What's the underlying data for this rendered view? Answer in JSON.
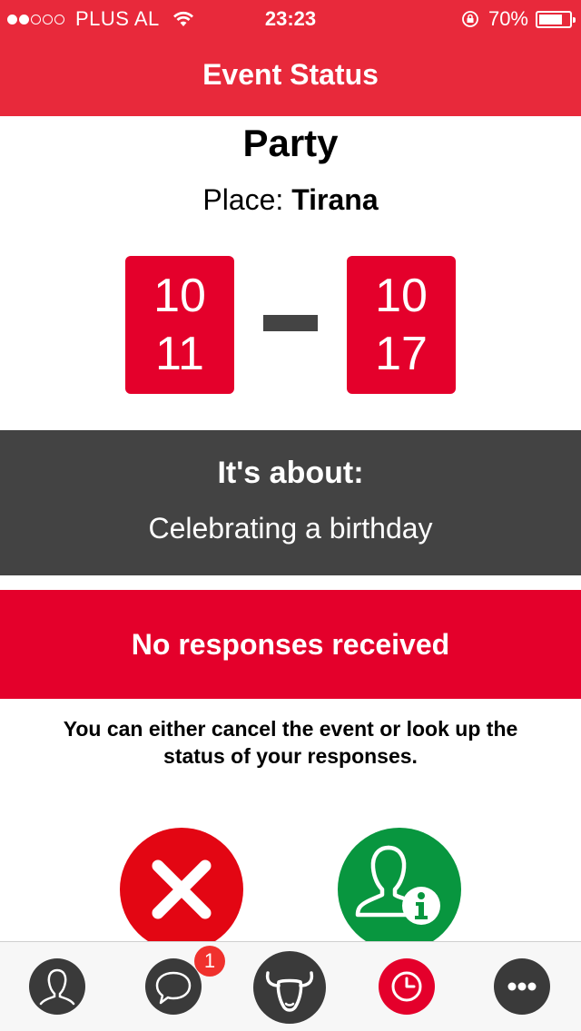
{
  "status_bar": {
    "carrier": "PLUS AL",
    "time": "23:23",
    "battery_percent": "70%",
    "signal_bars": 2,
    "battery_level": 0.7
  },
  "nav": {
    "title": "Event Status"
  },
  "event": {
    "name": "Party",
    "place_label": "Place:",
    "place_value": "Tirana",
    "start": {
      "line1": "10",
      "line2": "11"
    },
    "end": {
      "line1": "10",
      "line2": "17"
    }
  },
  "about": {
    "title": "It's about:",
    "text": "Celebrating a birthday"
  },
  "banner": {
    "text": "No responses received"
  },
  "info": {
    "text": "You can either cancel the event or look up the status of your responses."
  },
  "actions": {
    "cancel_icon": "close-icon",
    "status_icon": "user-info-icon"
  },
  "tabbar": {
    "items": [
      {
        "icon": "profile-icon"
      },
      {
        "icon": "chat-icon",
        "badge": "1"
      },
      {
        "icon": "bull-logo-icon"
      },
      {
        "icon": "clock-icon",
        "active": true
      },
      {
        "icon": "more-icon"
      }
    ]
  },
  "colors": {
    "header": "#e8293b",
    "accent_red": "#e4002b",
    "dark_gray": "#434343",
    "green": "#08963f"
  }
}
